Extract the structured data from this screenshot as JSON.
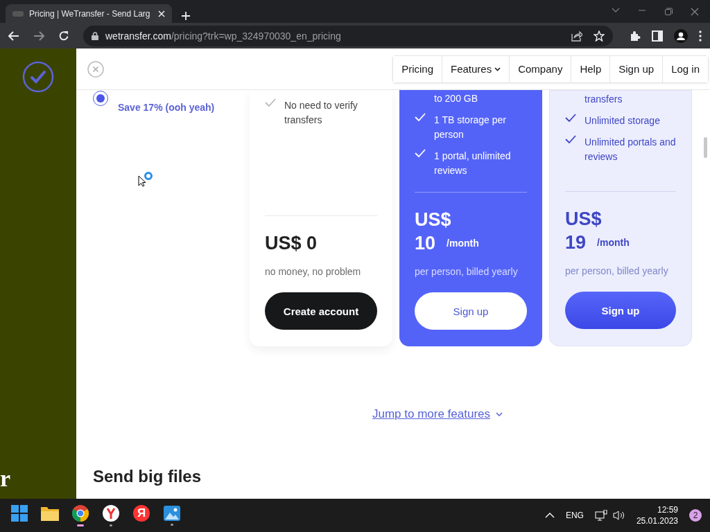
{
  "browser": {
    "tab": {
      "title": "Pricing | WeTransfer - Send Larg",
      "selected": true
    },
    "url": {
      "domain": "wetransfer.com",
      "path": "/pricing?trk=wp_324970030_en_pricing"
    }
  },
  "sidebar": {
    "letter": "r"
  },
  "nav": [
    {
      "label": "Pricing",
      "dropdown": false
    },
    {
      "label": "Features",
      "dropdown": true
    },
    {
      "label": "Company",
      "dropdown": false
    },
    {
      "label": "Help",
      "dropdown": false
    },
    {
      "label": "Sign up",
      "dropdown": false
    },
    {
      "label": "Log in",
      "dropdown": false
    }
  ],
  "billing": {
    "selected": true,
    "savings": "Save 17% (ooh yeah)"
  },
  "plans": [
    {
      "kind": "plain",
      "features": [
        {
          "text": "No need to verify transfers",
          "check": true
        }
      ],
      "currency": "US$",
      "amount": "0",
      "note": "no money, no problem",
      "button": "Create account"
    },
    {
      "kind": "accent",
      "features": [
        {
          "text": "to 200 GB",
          "check": false
        },
        {
          "text": "1 TB storage per person",
          "check": true
        },
        {
          "text": "1 portal, unlimited reviews",
          "check": true
        }
      ],
      "currency": "US$",
      "amount": "10",
      "period": "/month",
      "note": "per person, billed yearly",
      "button": "Sign up"
    },
    {
      "kind": "tint",
      "features": [
        {
          "text": "transfers",
          "check": false
        },
        {
          "text": "Unlimited storage",
          "check": true
        },
        {
          "text": "Unlimited portals and reviews",
          "check": true
        }
      ],
      "currency": "US$",
      "amount": "19",
      "period": "/month",
      "note": "per person, billed yearly",
      "button": "Sign up"
    }
  ],
  "jump_link": "Jump to more features",
  "section_heading": "Send big files",
  "taskbar": {
    "apps": [
      {
        "kind": "windows",
        "running": false,
        "active": false
      },
      {
        "kind": "folder",
        "running": false,
        "active": false
      },
      {
        "kind": "chrome",
        "running": true,
        "active": true
      },
      {
        "kind": "yandex",
        "running": true,
        "active": false
      },
      {
        "kind": "letter",
        "label": "Я",
        "running": false,
        "active": false
      },
      {
        "kind": "photos",
        "running": true,
        "active": false
      }
    ],
    "language": "ENG",
    "time": "12:59",
    "date": "25.01.2023",
    "notifications": "2"
  }
}
